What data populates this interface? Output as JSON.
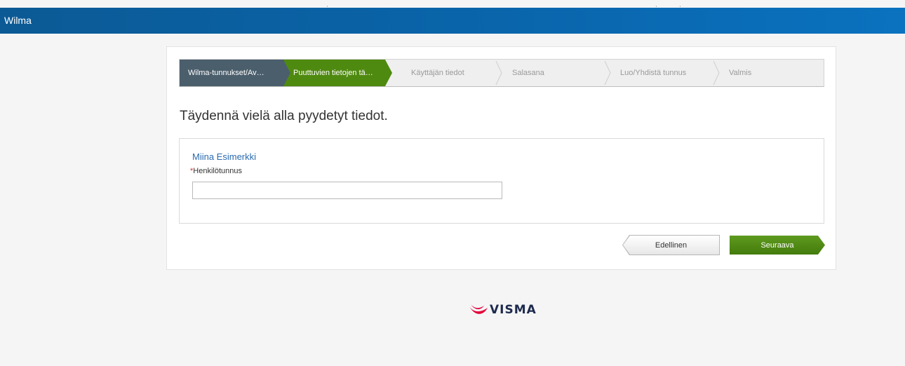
{
  "header": {
    "app_title": "Wilma",
    "bg_color": "#0a66ad"
  },
  "wizard": {
    "steps": [
      {
        "label": "Wilma-tunnukset/Av…",
        "state": "done"
      },
      {
        "label": "Puuttuvien tietojen tä…",
        "state": "active"
      },
      {
        "label": "Käyttäjän tiedot",
        "state": "pending"
      },
      {
        "label": "Salasana",
        "state": "pending"
      },
      {
        "label": "Luo/Yhdistä tunnus",
        "state": "pending"
      },
      {
        "label": "Valmis",
        "state": "pending"
      }
    ],
    "done_color": "#4b5e6c",
    "active_color": "#4f8a10"
  },
  "main": {
    "title": "Täydennä vielä alla pyydetyt tiedot."
  },
  "form": {
    "person_name": "Miina Esimerkki",
    "required_mark": "*",
    "ssn_label": "Henkilötunnus",
    "ssn_value": ""
  },
  "buttons": {
    "previous_label": "Edellinen",
    "next_label": "Seuraava"
  },
  "footer": {
    "logo_text": "VISMA",
    "logo_icon": "visma-swoosh-icon",
    "logo_color": "#e4003b"
  }
}
